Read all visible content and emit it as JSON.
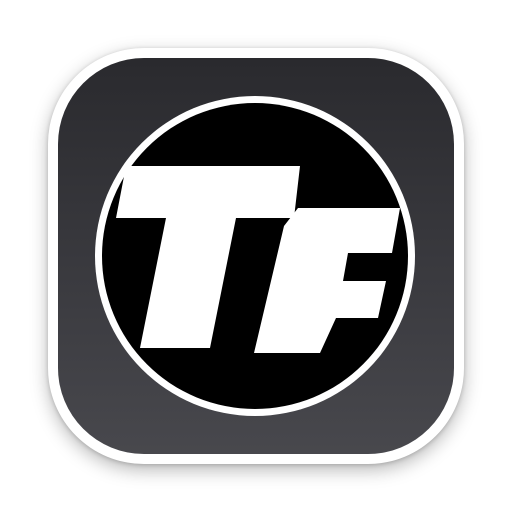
{
  "app_icon": {
    "monogram": "TF",
    "colors": {
      "icon_border": "#ffffff",
      "icon_background_top": "#2a2a2e",
      "icon_background_bottom": "#48484d",
      "circle_ring": "#ffffff",
      "circle_fill": "#000000",
      "letters": "#ffffff"
    }
  }
}
